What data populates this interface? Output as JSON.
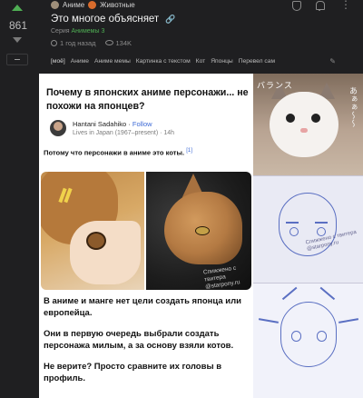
{
  "vote": {
    "score": "861"
  },
  "header": {
    "community": "Аниме",
    "subcommunity": "Животные",
    "title": "Это многое объясняет",
    "series_prefix": "Серия",
    "series_name": "Анимемы 3",
    "time_ago": "1 год назад",
    "views": "134K"
  },
  "tags": [
    "[моё]",
    "Аниме",
    "Аниме мемы",
    "Картинка с текстом",
    "Кот",
    "Японцы",
    "Перевел сам"
  ],
  "image": {
    "question": "Почему в японских аниме персонажи... не похожи на японцев?",
    "author_name": "Hantani Sadahiko",
    "follow_label": "Follow",
    "author_bio": "Lives in Japan (1967–present) · 14h",
    "answer": "Потому что персонажи в аниме это коты.",
    "footnote": "[1]",
    "watermark": "Спижжено с твитера @starpony.ru",
    "paragraph1": "В аниме и манге нет цели создать японца или европейца.",
    "paragraph2": "Они в первую очередь выбрали создать персонажа милым, а за основу взяли котов.",
    "paragraph3": "Не верите? Просто сравните их головы в профиль.",
    "right_caption": "バランス",
    "right_vertical": "あぁぁ〜〜",
    "sketch_watermark": "Спижжено с твитера @starpony.ru"
  }
}
